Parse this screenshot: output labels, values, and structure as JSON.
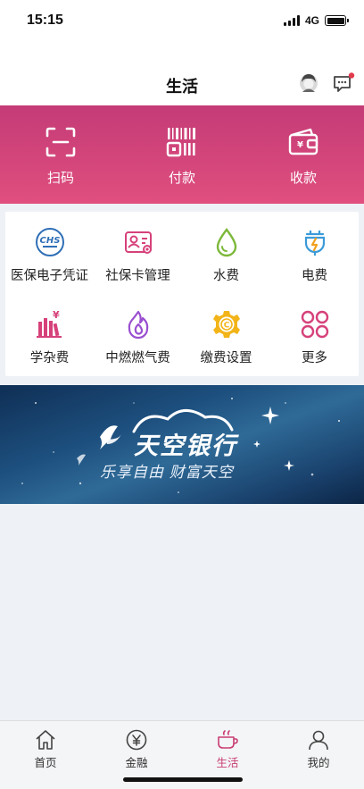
{
  "status_bar": {
    "time": "15:15",
    "network": "4G"
  },
  "nav": {
    "title": "生活"
  },
  "quick_actions": [
    {
      "label": "扫码",
      "icon": "scan-icon"
    },
    {
      "label": "付款",
      "icon": "pay-code-icon"
    },
    {
      "label": "收款",
      "icon": "wallet-icon"
    }
  ],
  "services": [
    {
      "label": "医保电子凭证",
      "icon": "chs-medical-insurance-icon"
    },
    {
      "label": "社保卡管理",
      "icon": "social-security-card-icon"
    },
    {
      "label": "水费",
      "icon": "water-drop-icon"
    },
    {
      "label": "电费",
      "icon": "electricity-icon"
    },
    {
      "label": "学杂费",
      "icon": "books-tuition-icon"
    },
    {
      "label": "中燃燃气费",
      "icon": "gas-flame-icon"
    },
    {
      "label": "缴费设置",
      "icon": "gear-settings-icon"
    },
    {
      "label": "更多",
      "icon": "more-grid-icon"
    }
  ],
  "banner": {
    "title": "天空银行",
    "slogan": "乐享自由  财富天空"
  },
  "tabs": [
    {
      "label": "首页",
      "icon": "home-icon"
    },
    {
      "label": "金融",
      "icon": "finance-yuan-icon"
    },
    {
      "label": "生活",
      "icon": "life-cup-icon",
      "active": true
    },
    {
      "label": "我的",
      "icon": "profile-icon"
    }
  ],
  "colors": {
    "accent": "#c83e72",
    "hero_top": "#c43b77",
    "hero_bottom": "#e04f7e",
    "banner": "#1d4f7e",
    "background": "#eef1f5"
  }
}
